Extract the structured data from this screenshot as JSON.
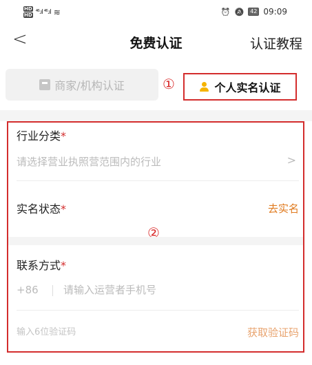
{
  "status_bar": {
    "hd1": "HD",
    "hd2": "HD",
    "signal": "⁴⁶.ıl ⁴⁶.ıl",
    "wifi": "≋",
    "alarm": "⏰",
    "mute": "🔕",
    "battery": "42",
    "time": "09:09"
  },
  "header": {
    "back": "<",
    "title": "免费认证",
    "tutorial": "认证教程"
  },
  "tabs": {
    "merchant": "商家/机构认证",
    "personal": "个人实名认证",
    "marker1": "①"
  },
  "form": {
    "industry_label": "行业分类",
    "industry_placeholder": "请选择营业执照营范围内的行业",
    "industry_chevron": ">",
    "realname_label": "实名状态",
    "realname_action": "去实名",
    "marker2": "②",
    "contact_label": "联系方式",
    "required_mark": "*",
    "phone_prefix": "+86",
    "phone_placeholder": "请输入运营者手机号",
    "code_placeholder": "输入6位验证码",
    "get_code": "获取验证码"
  },
  "colors": {
    "accent_red": "#d32c2c",
    "action_orange": "#e07a1e",
    "icon_yellow": "#f5b400"
  }
}
